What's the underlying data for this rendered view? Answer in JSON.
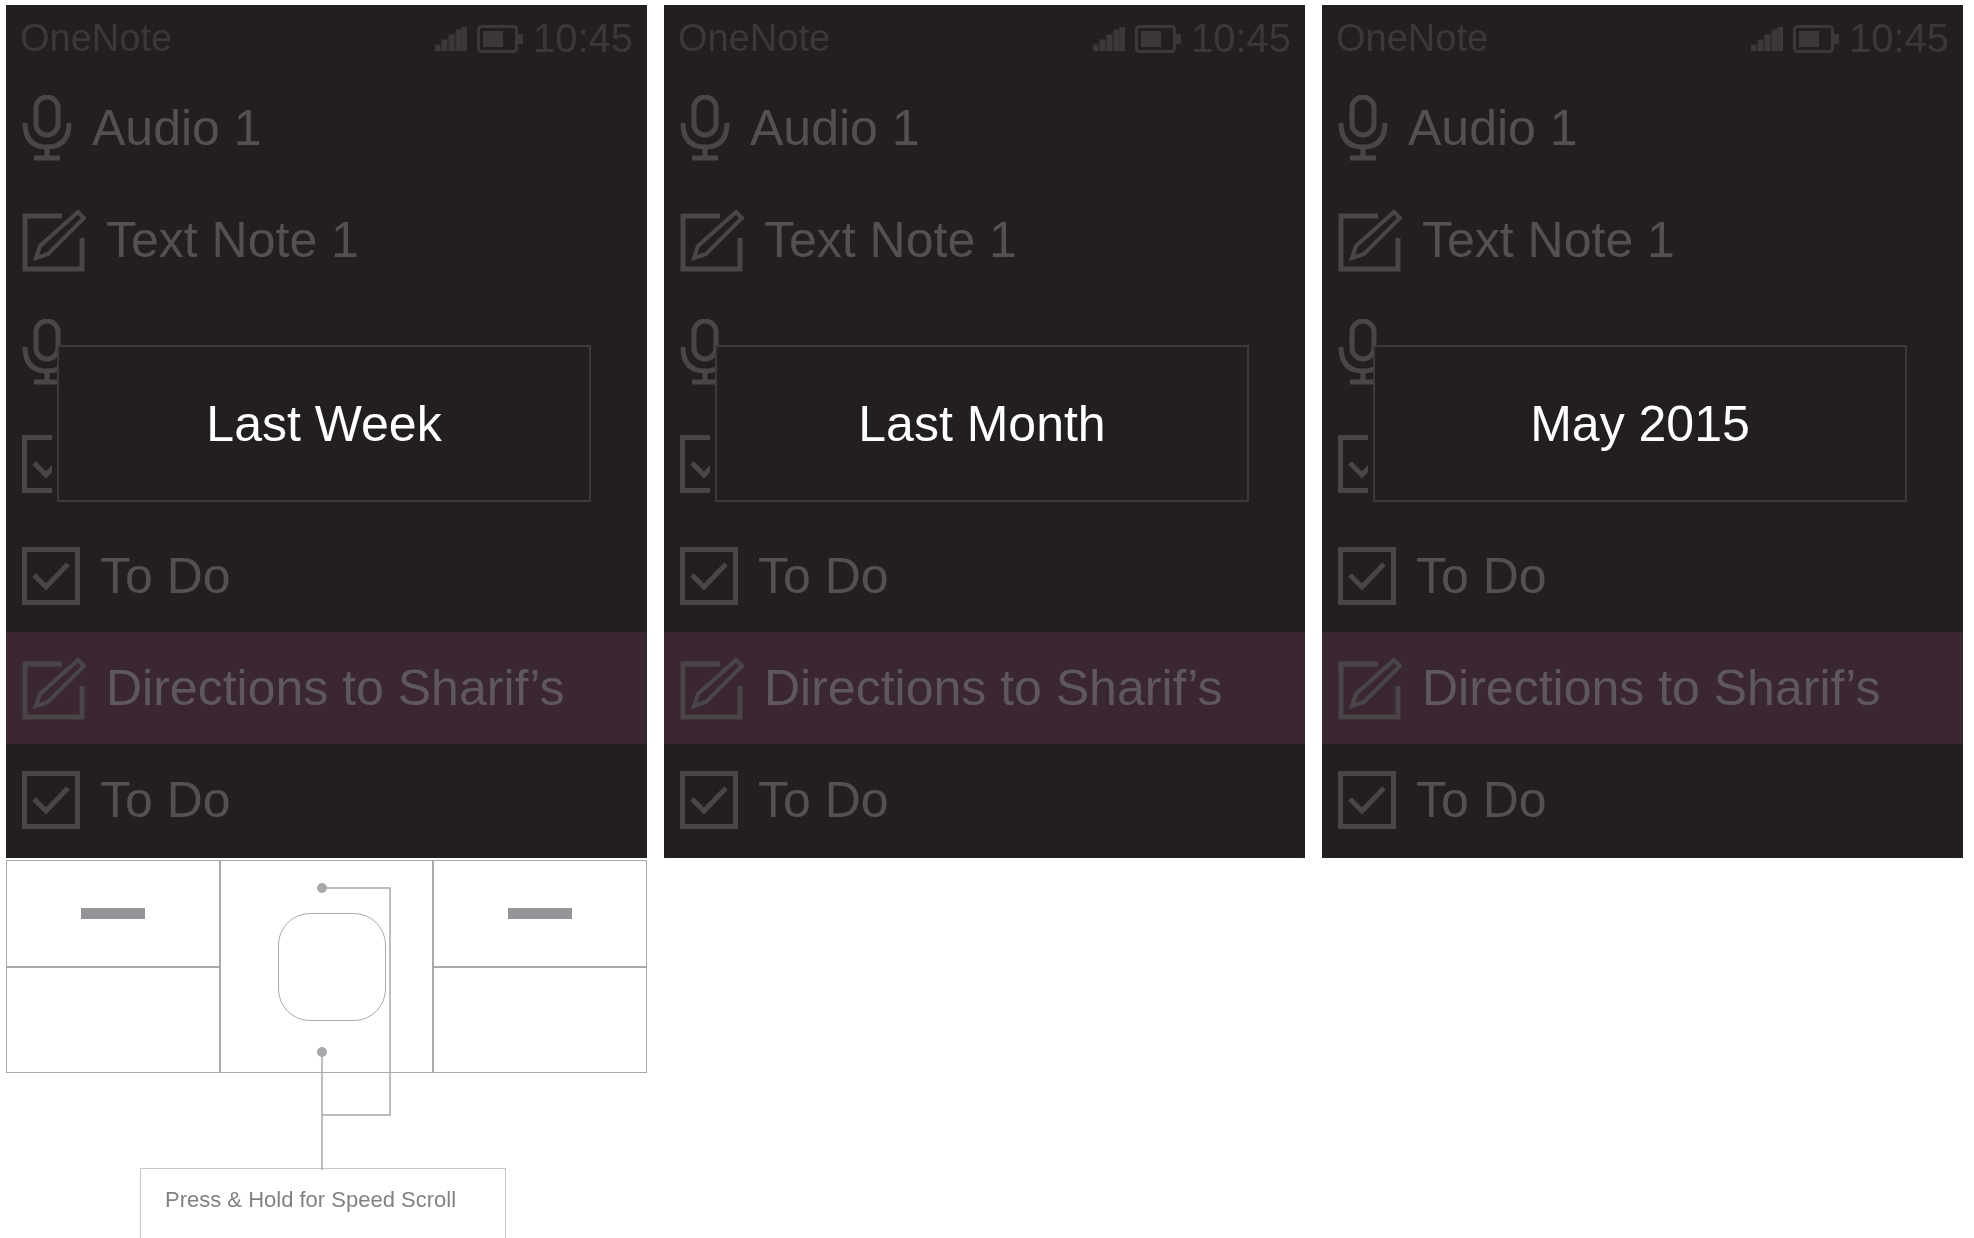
{
  "screens": [
    {
      "app_title": "OneNote",
      "time": "10:45",
      "items": [
        {
          "kind": "audio",
          "label": "Audio 1",
          "selected": false
        },
        {
          "kind": "note",
          "label": "Text Note 1",
          "selected": false
        },
        {
          "kind": "audio",
          "selected": false
        },
        {
          "kind": "todo",
          "selected": false
        },
        {
          "kind": "todo",
          "label": "To Do",
          "selected": false
        },
        {
          "kind": "note",
          "label": "Directions to Sharif’s",
          "selected": true
        },
        {
          "kind": "todo",
          "label": "To Do",
          "selected": false
        }
      ],
      "popup": "Last Week"
    },
    {
      "app_title": "OneNote",
      "time": "10:45",
      "items": [
        {
          "kind": "audio",
          "label": "Audio 1",
          "selected": false
        },
        {
          "kind": "note",
          "label": "Text Note 1",
          "selected": false
        },
        {
          "kind": "audio",
          "selected": false
        },
        {
          "kind": "todo",
          "selected": false
        },
        {
          "kind": "todo",
          "label": "To Do",
          "selected": false
        },
        {
          "kind": "note",
          "label": "Directions to Sharif’s",
          "selected": true
        },
        {
          "kind": "todo",
          "label": "To Do",
          "selected": false
        }
      ],
      "popup": "Last Month"
    },
    {
      "app_title": "OneNote",
      "time": "10:45",
      "items": [
        {
          "kind": "audio",
          "label": "Audio 1",
          "selected": false
        },
        {
          "kind": "note",
          "label": "Text Note 1",
          "selected": false
        },
        {
          "kind": "audio",
          "selected": false
        },
        {
          "kind": "todo",
          "selected": false
        },
        {
          "kind": "todo",
          "label": "To Do",
          "selected": false
        },
        {
          "kind": "note",
          "label": "Directions to Sharif’s",
          "selected": true
        },
        {
          "kind": "todo",
          "label": "To Do",
          "selected": false
        }
      ],
      "popup": "May 2015"
    }
  ],
  "callout": "Press & Hold for Speed Scroll"
}
